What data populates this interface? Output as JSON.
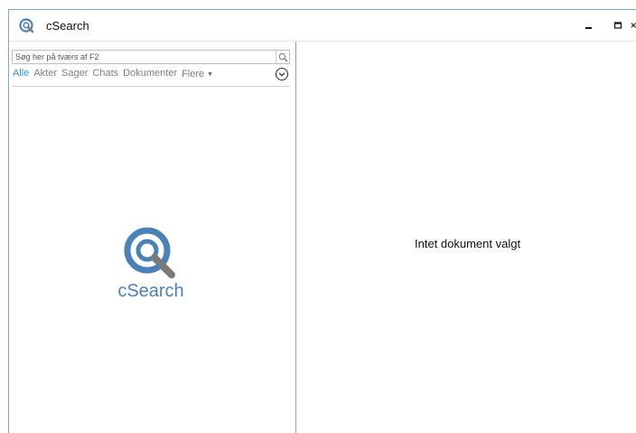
{
  "window": {
    "title": "cSearch",
    "controls": {
      "minimize_icon": "minimize-icon",
      "maximize_icon": "maximize-icon",
      "close_icon": "close-icon"
    }
  },
  "search": {
    "placeholder": "Søg her på tværs af F2",
    "value": "",
    "button_icon": "search-icon"
  },
  "filters": {
    "tabs": [
      "Alle",
      "Akter",
      "Sager",
      "Chats",
      "Dokumenter",
      "Flere"
    ],
    "active": "Alle",
    "more_icon": "caret-down-icon",
    "expand_icon": "chevron-down-circle-icon"
  },
  "logo": {
    "text": "cSearch"
  },
  "preview": {
    "empty_message": "Intet dokument valgt"
  },
  "colors": {
    "accent": "#2f8fdc",
    "logo_blue": "#4a82b8",
    "logo_gray": "#7a7a7a",
    "border": "#7aa7cf"
  }
}
